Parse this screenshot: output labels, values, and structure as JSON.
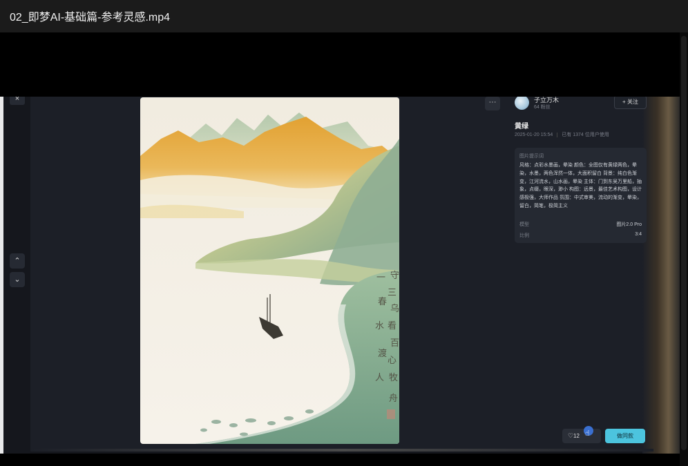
{
  "window": {
    "title": "02_即梦AI-基础篇-参考灵感.mp4"
  },
  "controls": {
    "close": "×",
    "up": "⌃",
    "down": "⌄",
    "more": "···"
  },
  "author": {
    "name": "子立万木",
    "followers": "64 粉丝",
    "follow_label": "+ 关注"
  },
  "artwork": {
    "title": "黄绿",
    "date": "2025-01-20 15:54",
    "usage": "已有 1374 位用户使用",
    "prompt_label": "图片提示词",
    "prompt": "风格：点彩水墨画，晕染 颜色：全图仅有黄绿两色，晕染，水墨，两色浑然一体，大面积留白 背景：纯白色渐变，江河流水，山水画，晕染 主体：门到东吴万里船，抽象，点缀，眼深，渺小 构图：远景，最佳艺术构图，设计感极强，大师作品 氛围：中式审美，流动的渐变，晕染，留白，简笔，极简主义",
    "model_label": "模型",
    "model_value": "图片2.0 Pro",
    "ratio_label": "比例",
    "ratio_value": "3:4"
  },
  "actions": {
    "like_icon": "♡",
    "like_count": "12",
    "same_label": "做同款"
  },
  "colors": {
    "accent": "#4cc4de",
    "panel": "#1c1f27"
  }
}
